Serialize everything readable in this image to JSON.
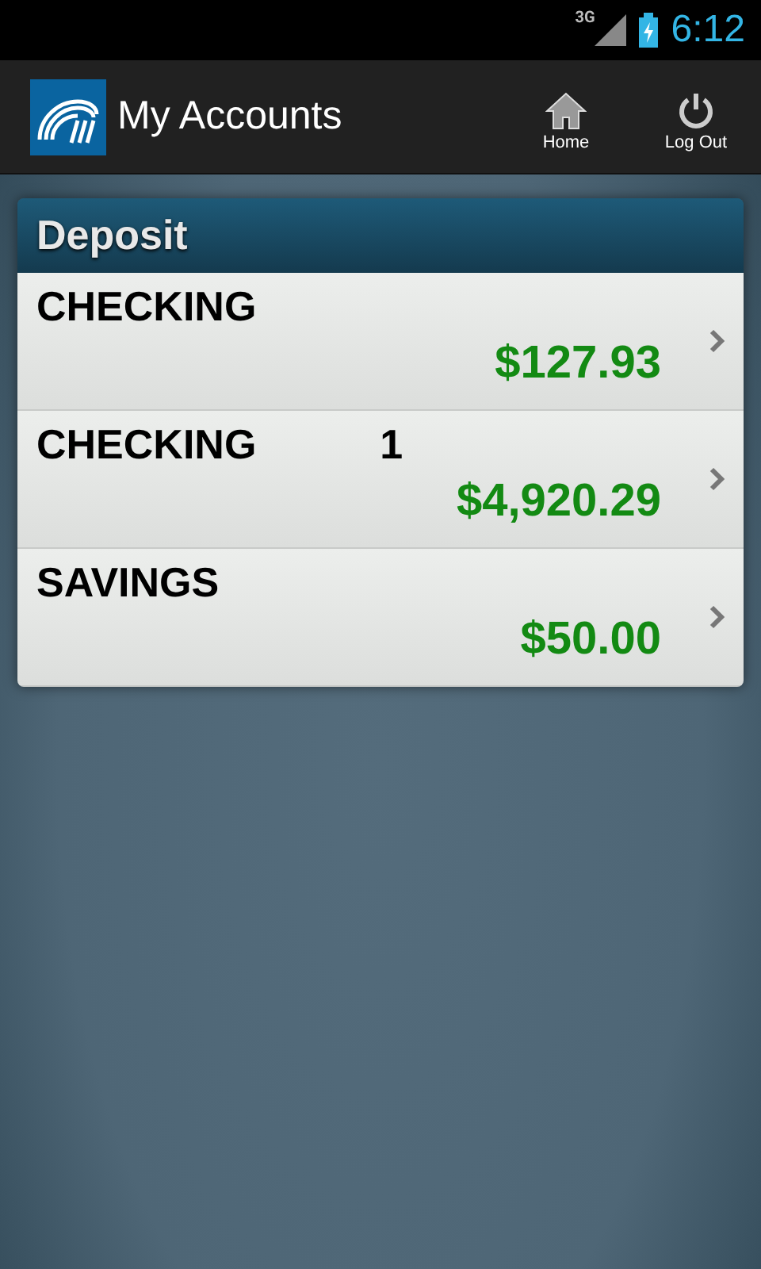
{
  "status_bar": {
    "network": "3G",
    "time": "6:12"
  },
  "app_bar": {
    "title": "My Accounts",
    "actions": [
      {
        "kind": "home",
        "label": "Home"
      },
      {
        "kind": "power",
        "label": "Log Out"
      }
    ]
  },
  "section": {
    "title": "Deposit",
    "accounts": [
      {
        "name": "CHECKING",
        "balance": "$127.93"
      },
      {
        "name": "CHECKING",
        "number": "1",
        "balance": "$4,920.29"
      },
      {
        "name": "SAVINGS",
        "balance": "$50.00"
      }
    ]
  }
}
